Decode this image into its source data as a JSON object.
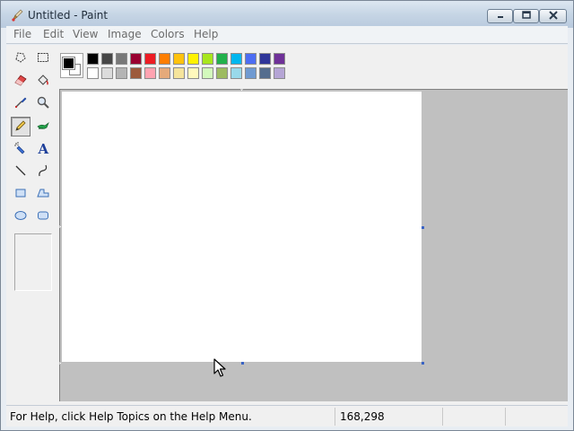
{
  "window": {
    "title": "Untitled - Paint",
    "app_icon": "paint-brush-icon"
  },
  "titlebar_buttons": [
    {
      "name": "minimize",
      "icon": "minimize-icon"
    },
    {
      "name": "maximize",
      "icon": "maximize-icon"
    },
    {
      "name": "close",
      "icon": "close-icon"
    }
  ],
  "menu": {
    "items": [
      "File",
      "Edit",
      "View",
      "Image",
      "Colors",
      "Help"
    ]
  },
  "toolbox": {
    "tools": [
      {
        "name": "free-form-select",
        "icon": "free-form-select-icon"
      },
      {
        "name": "select",
        "icon": "rect-select-icon"
      },
      {
        "name": "eraser",
        "icon": "eraser-icon"
      },
      {
        "name": "fill-with-color",
        "icon": "paint-bucket-icon"
      },
      {
        "name": "pick-color",
        "icon": "eyedropper-icon"
      },
      {
        "name": "magnifier",
        "icon": "magnifier-icon"
      },
      {
        "name": "pencil",
        "icon": "pencil-icon",
        "selected": true
      },
      {
        "name": "brush",
        "icon": "brush-icon"
      },
      {
        "name": "airbrush",
        "icon": "airbrush-icon"
      },
      {
        "name": "text",
        "icon": "text-icon"
      },
      {
        "name": "line",
        "icon": "line-icon"
      },
      {
        "name": "curve",
        "icon": "curve-icon"
      },
      {
        "name": "rectangle",
        "icon": "rectangle-icon"
      },
      {
        "name": "polygon",
        "icon": "polygon-icon"
      },
      {
        "name": "ellipse",
        "icon": "ellipse-icon"
      },
      {
        "name": "rounded-rectangle",
        "icon": "rounded-rectangle-icon"
      }
    ]
  },
  "colors": {
    "foreground": "#000000",
    "background": "#ffffff",
    "palette_row1": [
      "#000000",
      "#464646",
      "#787878",
      "#990030",
      "#ed1c24",
      "#ff7e00",
      "#ffc20e",
      "#fff200",
      "#a8e61d",
      "#22b14c",
      "#00b7ef",
      "#4d6df3",
      "#2f3699",
      "#6f3198"
    ],
    "palette_row2": [
      "#ffffff",
      "#dcdcdc",
      "#b4b4b4",
      "#9c5a3c",
      "#ffa3b1",
      "#e5aa7a",
      "#f5e49c",
      "#fff9bd",
      "#d3f9bc",
      "#9dbb61",
      "#99d9ea",
      "#709ad1",
      "#546d8e",
      "#b5a5d5"
    ]
  },
  "status": {
    "help_text": "For Help, click Help Topics on the Help Menu.",
    "coordinates": "168,298"
  }
}
